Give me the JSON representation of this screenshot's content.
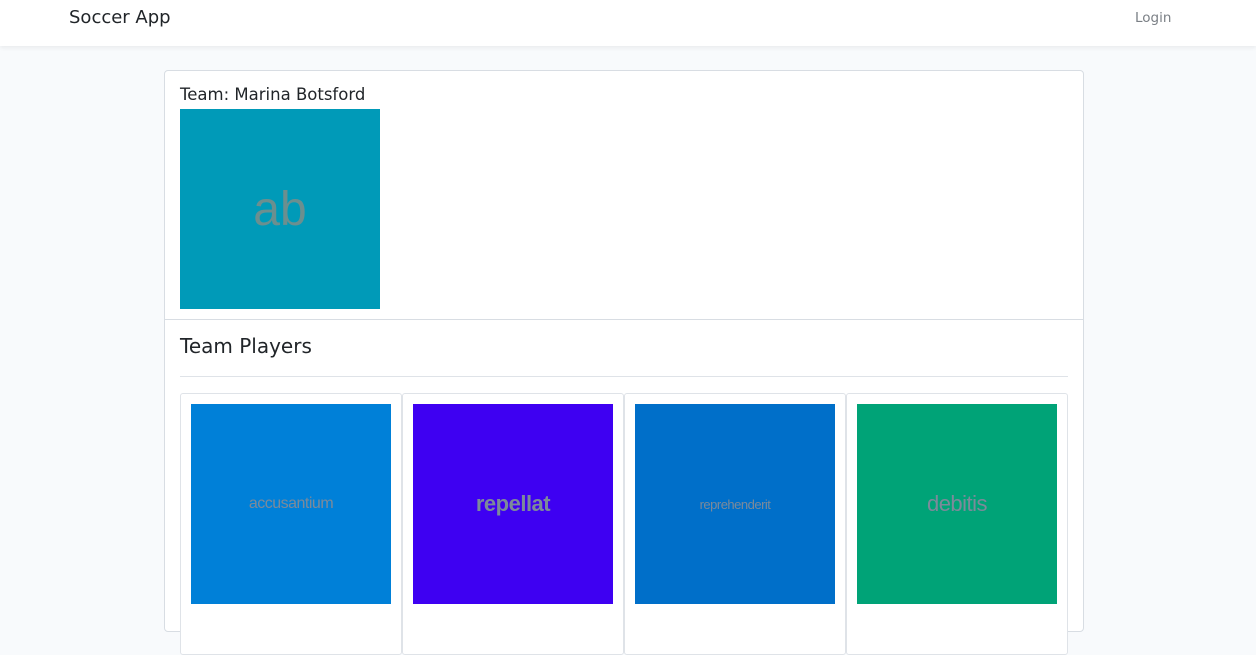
{
  "navbar": {
    "brand": "Soccer App",
    "login": "Login"
  },
  "team": {
    "title": "Team: Marina Botsford",
    "image_text": "ab",
    "image_color": "#009ab8"
  },
  "players": {
    "heading": "Team Players",
    "items": [
      {
        "image_text": "accusantium",
        "image_color": "#0080d8"
      },
      {
        "image_text": "repellat",
        "image_color": "#3e00f2"
      },
      {
        "image_text": "reprehenderit",
        "image_color": "#006fc9"
      },
      {
        "image_text": "debitis",
        "image_color": "#00a377"
      }
    ]
  }
}
